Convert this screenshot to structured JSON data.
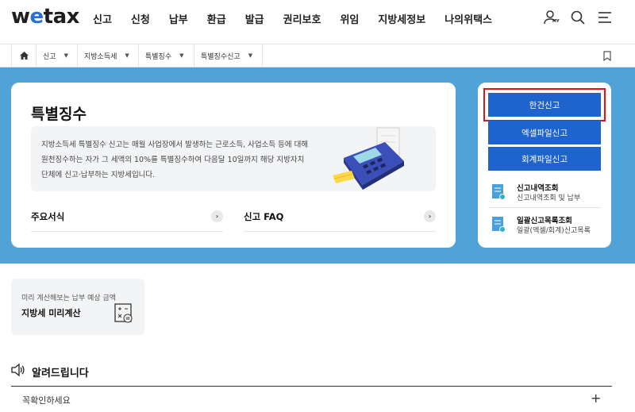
{
  "logo": {
    "prefix": "w",
    "accent": "e",
    "suffix": "tax",
    "accent_color": "#2b6fd6"
  },
  "nav": {
    "items": [
      "신고",
      "신청",
      "납부",
      "환급",
      "발급",
      "권리보호",
      "위임",
      "지방세정보",
      "나의위택스"
    ]
  },
  "header_icons": [
    "my-user-icon",
    "search-icon",
    "menu-icon"
  ],
  "my_label": "MY",
  "breadcrumb": {
    "items": [
      "신고",
      "지방소득세",
      "특별징수",
      "특별징수신고"
    ]
  },
  "card": {
    "title": "특별징수",
    "description": "지방소득세 특별징수 신고는 매월 사업장에서 발생하는 근로소득, 사업소득 등에 대해 원천징수하는 자가 그 세액의 10%를 특별징수하여 다음달 10일까지 해당 지방자치단체에 신고·납부하는 지방세입니다.",
    "links": [
      "주요서식",
      "신고 FAQ"
    ]
  },
  "side": {
    "buttons": [
      "한건신고",
      "엑셀파일신고",
      "회계파일신고"
    ],
    "items": [
      {
        "title": "신고내역조회",
        "sub": "신고내역조회 및 납부"
      },
      {
        "title": "일괄신고목록조회",
        "sub": "일괄(엑셀/회계)신고목록"
      }
    ]
  },
  "calc": {
    "line1": "미리 계산해보는 납부 예상 금액",
    "line2": "지방세 미리계산"
  },
  "notice": {
    "title": "알려드립니다",
    "row": "꼭확인하세요",
    "plus": "+"
  },
  "colors": {
    "primary": "#1f63cc",
    "band": "#4fa3d6",
    "highlight": "#e0121b"
  }
}
